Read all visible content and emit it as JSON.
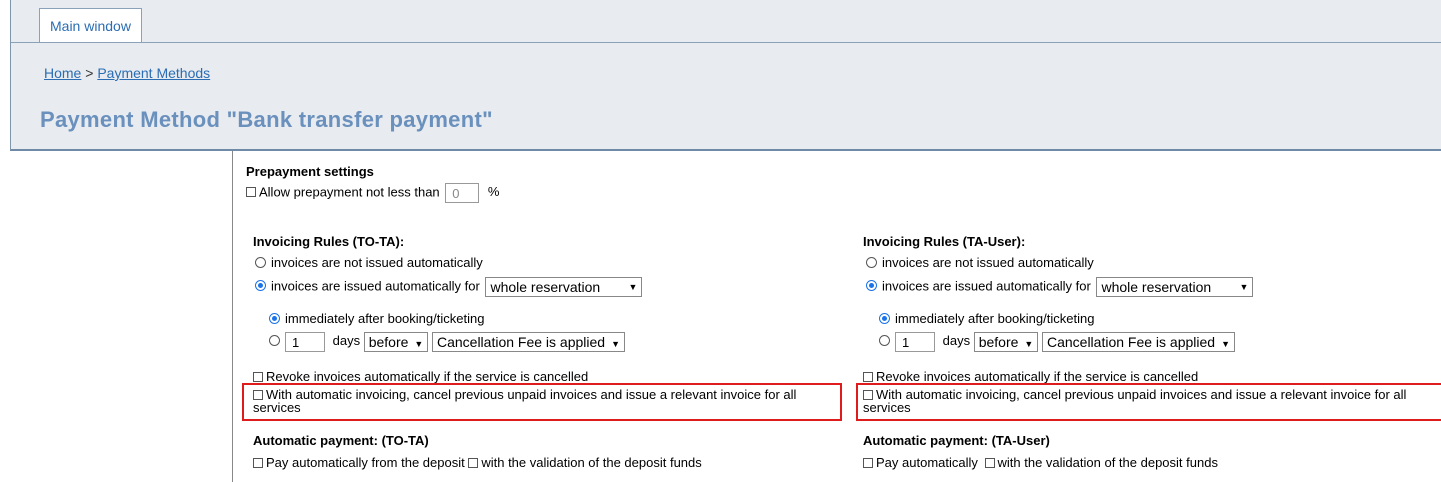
{
  "tab": {
    "label": "Main window"
  },
  "breadcrumb": {
    "home": "Home",
    "separator": " > ",
    "current": " Payment Methods"
  },
  "page": {
    "title": "Payment Method \"Bank transfer payment\""
  },
  "prepayment": {
    "heading": "Prepayment settings",
    "allow_label": "Allow prepayment not less than",
    "value": "0",
    "unit": "%"
  },
  "left": {
    "heading": "Invoicing Rules (TO-TA):",
    "opt_not_issued": "invoices are not issued automatically",
    "opt_issued": "invoices are issued automatically for",
    "scope_value": "whole reservation",
    "opt_immediately": "immediately after booking/ticketing",
    "days_value": "1",
    "days_label": "days",
    "before_value": "before",
    "fee_value": "Cancellation Fee is applied",
    "revoke_label": "Revoke invoices automatically if the service is cancelled",
    "cancel_label": "With automatic invoicing, cancel previous unpaid invoices and issue a relevant invoice for all services",
    "auto_heading": "Automatic payment: (TO-TA)",
    "pay_label": "Pay automatically from the deposit",
    "validation_label": "with the validation of the deposit funds"
  },
  "right": {
    "heading": "Invoicing Rules (TA-User):",
    "opt_not_issued": "invoices are not issued automatically",
    "opt_issued": "invoices are issued automatically for",
    "scope_value": "whole reservation",
    "opt_immediately": "immediately after booking/ticketing",
    "days_value": "1",
    "days_label": "days",
    "before_value": "before",
    "fee_value": "Cancellation Fee is applied",
    "revoke_label": "Revoke invoices automatically if the service is cancelled",
    "cancel_label": "With automatic invoicing, cancel previous unpaid invoices and issue a relevant invoice for all services",
    "auto_heading": "Automatic payment: (TA-User)",
    "pay_label": "Pay automatically",
    "validation_label": "with the validation of the deposit funds"
  },
  "colors": {
    "accent": "#2a6db3",
    "title": "#6a90bd",
    "highlight": "#e01b1b",
    "header_bg": "#e8ebef"
  }
}
